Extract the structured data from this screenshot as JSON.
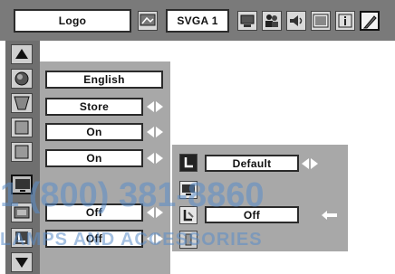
{
  "toolbar": {
    "logo_label": "Logo",
    "resolution_label": "SVGA 1"
  },
  "main_menu": {
    "language": "English",
    "store_label": "Store",
    "option1": "On",
    "option2": "On",
    "option3": "Off",
    "option4": "Off"
  },
  "sub_menu": {
    "mode": "Default",
    "value": "Off"
  },
  "watermark": {
    "phone": "1 (800) 381-8860",
    "brand": "LAMPS AND ACCESSORIES"
  },
  "colors": {
    "toolbar_bg": "#7a7a7a",
    "panel_bg": "#a8a8a8",
    "field_bg": "#ffffff",
    "watermark": "#5a8cc8"
  },
  "icons": [
    "picture-adjust-icon",
    "pc-icon",
    "people-icon",
    "sound-icon",
    "image-icon",
    "info-icon",
    "pen-icon",
    "up-arrow-icon",
    "color-circle-icon",
    "keystone-icon",
    "square-icon",
    "monitor-icon",
    "tv-icon",
    "letter-l-icon",
    "down-arrow-icon",
    "back-arrow-icon"
  ]
}
